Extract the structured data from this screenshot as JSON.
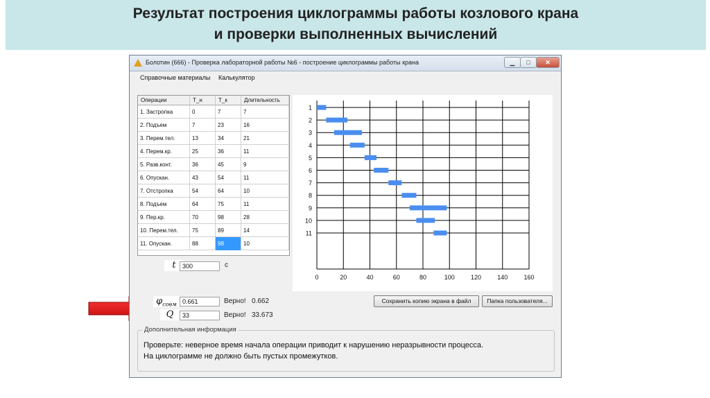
{
  "slide": {
    "title_line1": "Результат  построения циклограммы работы козлового крана",
    "title_line2": "и проверки выполненных вычислений"
  },
  "window": {
    "title": "Болотин (666) - Проверка лабораторной работы №6 - построение циклограммы работы крана",
    "buttons": {
      "minimize": "▁",
      "maximize": "□",
      "close": "✕"
    }
  },
  "menu": {
    "items": [
      "Справочные материалы",
      "Калькулятор"
    ]
  },
  "table": {
    "columns": [
      "Операции",
      "Т_н",
      "Т_к",
      "Длительность"
    ],
    "rows": [
      [
        "1. Застропка",
        "0",
        "7",
        "7"
      ],
      [
        "2. Подъем",
        "7",
        "23",
        "16"
      ],
      [
        "3. Перем.тел.",
        "13",
        "34",
        "21"
      ],
      [
        "4. Перем.кр.",
        "25",
        "36",
        "11"
      ],
      [
        "5. Разв.конт.",
        "36",
        "45",
        "9"
      ],
      [
        "6. Опускан.",
        "43",
        "54",
        "11"
      ],
      [
        "7. Отстропка",
        "54",
        "64",
        "10"
      ],
      [
        "8. Подъем",
        "64",
        "75",
        "11"
      ],
      [
        "9. Пер.кр.",
        "70",
        "98",
        "28"
      ],
      [
        "10. Перем.тел.",
        "75",
        "89",
        "14"
      ],
      [
        "11. Опускан.",
        "88",
        "98",
        "10"
      ]
    ],
    "selected_cell": {
      "row": 10,
      "col": 2
    }
  },
  "chart_data": {
    "type": "bar",
    "orientation": "horizontal-gantt",
    "categories": [
      "1",
      "2",
      "3",
      "4",
      "5",
      "6",
      "7",
      "8",
      "9",
      "10",
      "11"
    ],
    "series": [
      {
        "starts": [
          0,
          7,
          13,
          25,
          36,
          43,
          54,
          64,
          70,
          75,
          88
        ],
        "ends": [
          7,
          23,
          34,
          36,
          45,
          54,
          64,
          75,
          98,
          89,
          98
        ]
      }
    ],
    "xlim": [
      0,
      160
    ],
    "xticks": [
      "0",
      "20",
      "40",
      "60",
      "80",
      "100",
      "120",
      "140",
      "160"
    ],
    "grid": true,
    "bar_color": "#4a8ef0"
  },
  "fields": {
    "t": {
      "symbol": "t",
      "value": "300",
      "unit": "с"
    },
    "phi": {
      "symbol": "φ",
      "subscript": "совм",
      "value": "0.661",
      "status": "Верно!",
      "check": "0.662"
    },
    "q": {
      "symbol": "Q",
      "value": "33",
      "status": "Верно!",
      "check": "33.673"
    }
  },
  "buttons": {
    "save_screen": "Сохранить копию экрана в файл",
    "user_folder": "Папка пользователя..."
  },
  "info": {
    "title": "Дополнительная информация",
    "line1": "Проверьте: неверное время начала операции приводит к нарушению неразрывности процесса.",
    "line2": "На циклограмме не должно быть пустых промежутков."
  },
  "colors": {
    "header_bg": "#c9e6e8",
    "arrow": "#e8141a",
    "selection": "#3399ff"
  }
}
